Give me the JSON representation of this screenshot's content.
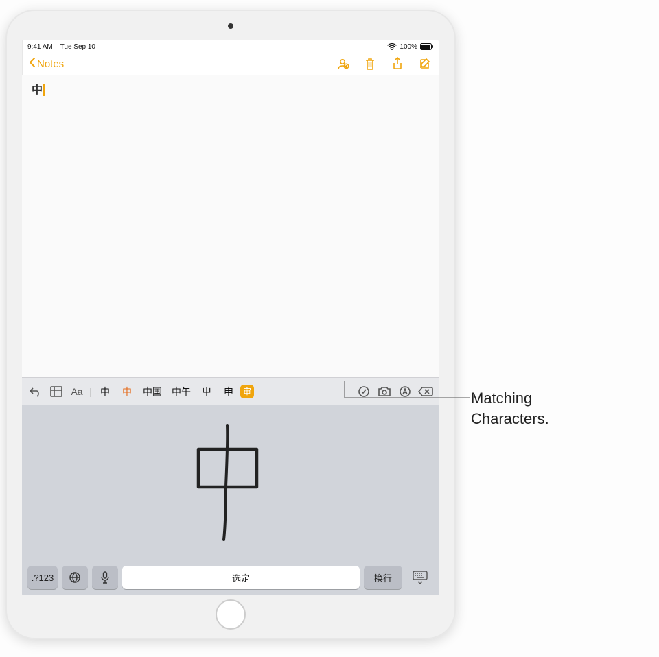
{
  "statusbar": {
    "time": "9:41 AM",
    "date": "Tue Sep 10",
    "battery_pct": "100%"
  },
  "navbar": {
    "back_label": "Notes"
  },
  "note": {
    "text": "中"
  },
  "candidate_bar": {
    "items": [
      "中",
      "中",
      "中国",
      "中午",
      "屮",
      "申",
      "审"
    ]
  },
  "keyboard": {
    "symbol_key": ".?123",
    "spacebar_label": "选定",
    "return_label": "换行"
  },
  "callout": {
    "line1": "Matching",
    "line2": "Characters."
  }
}
